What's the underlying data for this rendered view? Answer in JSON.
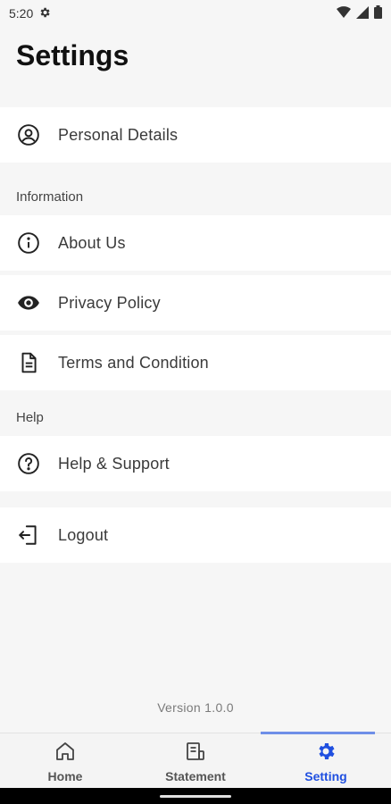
{
  "status_bar": {
    "time": "5:20",
    "icons": [
      "gear-icon",
      "wifi-icon",
      "signal-icon",
      "battery-icon"
    ]
  },
  "page": {
    "title": "Settings"
  },
  "items": {
    "personal_details": {
      "label": "Personal Details",
      "icon": "account-circle-icon"
    },
    "about_us": {
      "label": "About Us",
      "icon": "info-icon"
    },
    "privacy_policy": {
      "label": "Privacy Policy",
      "icon": "eye-icon"
    },
    "terms": {
      "label": "Terms and Condition",
      "icon": "document-icon"
    },
    "help_support": {
      "label": "Help & Support",
      "icon": "help-circle-icon"
    },
    "logout": {
      "label": "Logout",
      "icon": "logout-icon"
    }
  },
  "sections": {
    "information": "Information",
    "help": "Help"
  },
  "version": "Version 1.0.0",
  "nav": {
    "home": "Home",
    "statement": "Statement",
    "setting": "Setting",
    "active": "setting",
    "active_color": "#1f4fe0"
  }
}
